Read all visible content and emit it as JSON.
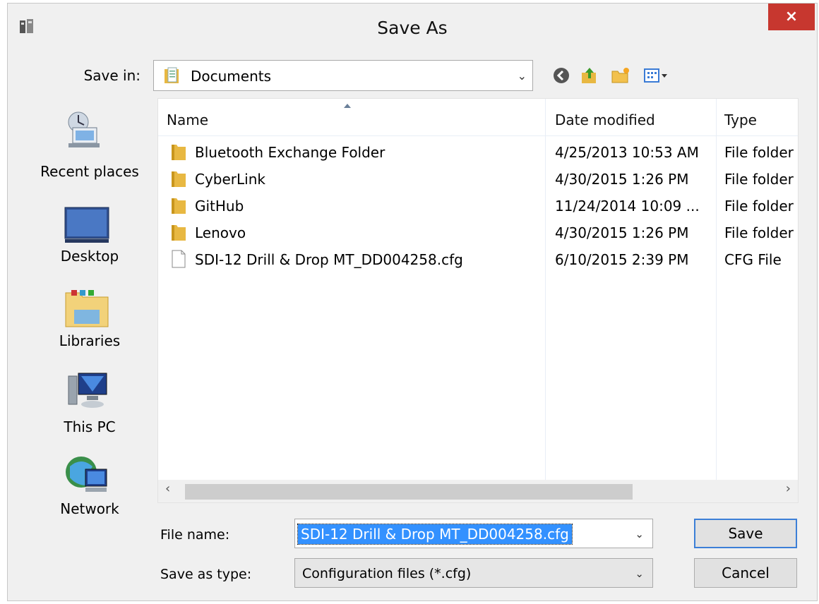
{
  "window": {
    "title": "Save As",
    "close_label": "×"
  },
  "save_in": {
    "label": "Save in:",
    "value": "Documents"
  },
  "toolbar": {
    "icons": [
      "back-icon",
      "up-folder-icon",
      "new-folder-icon",
      "view-menu-icon"
    ]
  },
  "places": [
    {
      "label": "Recent places",
      "icon": "recent-places-icon"
    },
    {
      "label": "Desktop",
      "icon": "desktop-icon"
    },
    {
      "label": "Libraries",
      "icon": "libraries-icon"
    },
    {
      "label": "This PC",
      "icon": "this-pc-icon"
    },
    {
      "label": "Network",
      "icon": "network-icon"
    }
  ],
  "file_list": {
    "columns": {
      "name": "Name",
      "date": "Date modified",
      "type": "Type"
    },
    "rows": [
      {
        "name": "Bluetooth Exchange Folder",
        "date": "4/25/2013 10:53 AM",
        "type": "File folder",
        "kind": "folder"
      },
      {
        "name": "CyberLink",
        "date": "4/30/2015 1:26 PM",
        "type": "File folder",
        "kind": "folder"
      },
      {
        "name": "GitHub",
        "date": "11/24/2014 10:09 ...",
        "type": "File folder",
        "kind": "folder"
      },
      {
        "name": "Lenovo",
        "date": "4/30/2015 1:26 PM",
        "type": "File folder",
        "kind": "folder"
      },
      {
        "name": "SDI-12 Drill & Drop MT_DD004258.cfg",
        "date": "6/10/2015 2:39 PM",
        "type": "CFG File",
        "kind": "file"
      }
    ]
  },
  "file_name": {
    "label": "File name:",
    "value": "SDI-12 Drill & Drop MT_DD004258.cfg"
  },
  "save_as_type": {
    "label": "Save as type:",
    "value": "Configuration files (*.cfg)"
  },
  "buttons": {
    "save": "Save",
    "cancel": "Cancel"
  },
  "colors": {
    "close": "#c7372f",
    "selection": "#3391ff",
    "folder": "#e8b842"
  }
}
